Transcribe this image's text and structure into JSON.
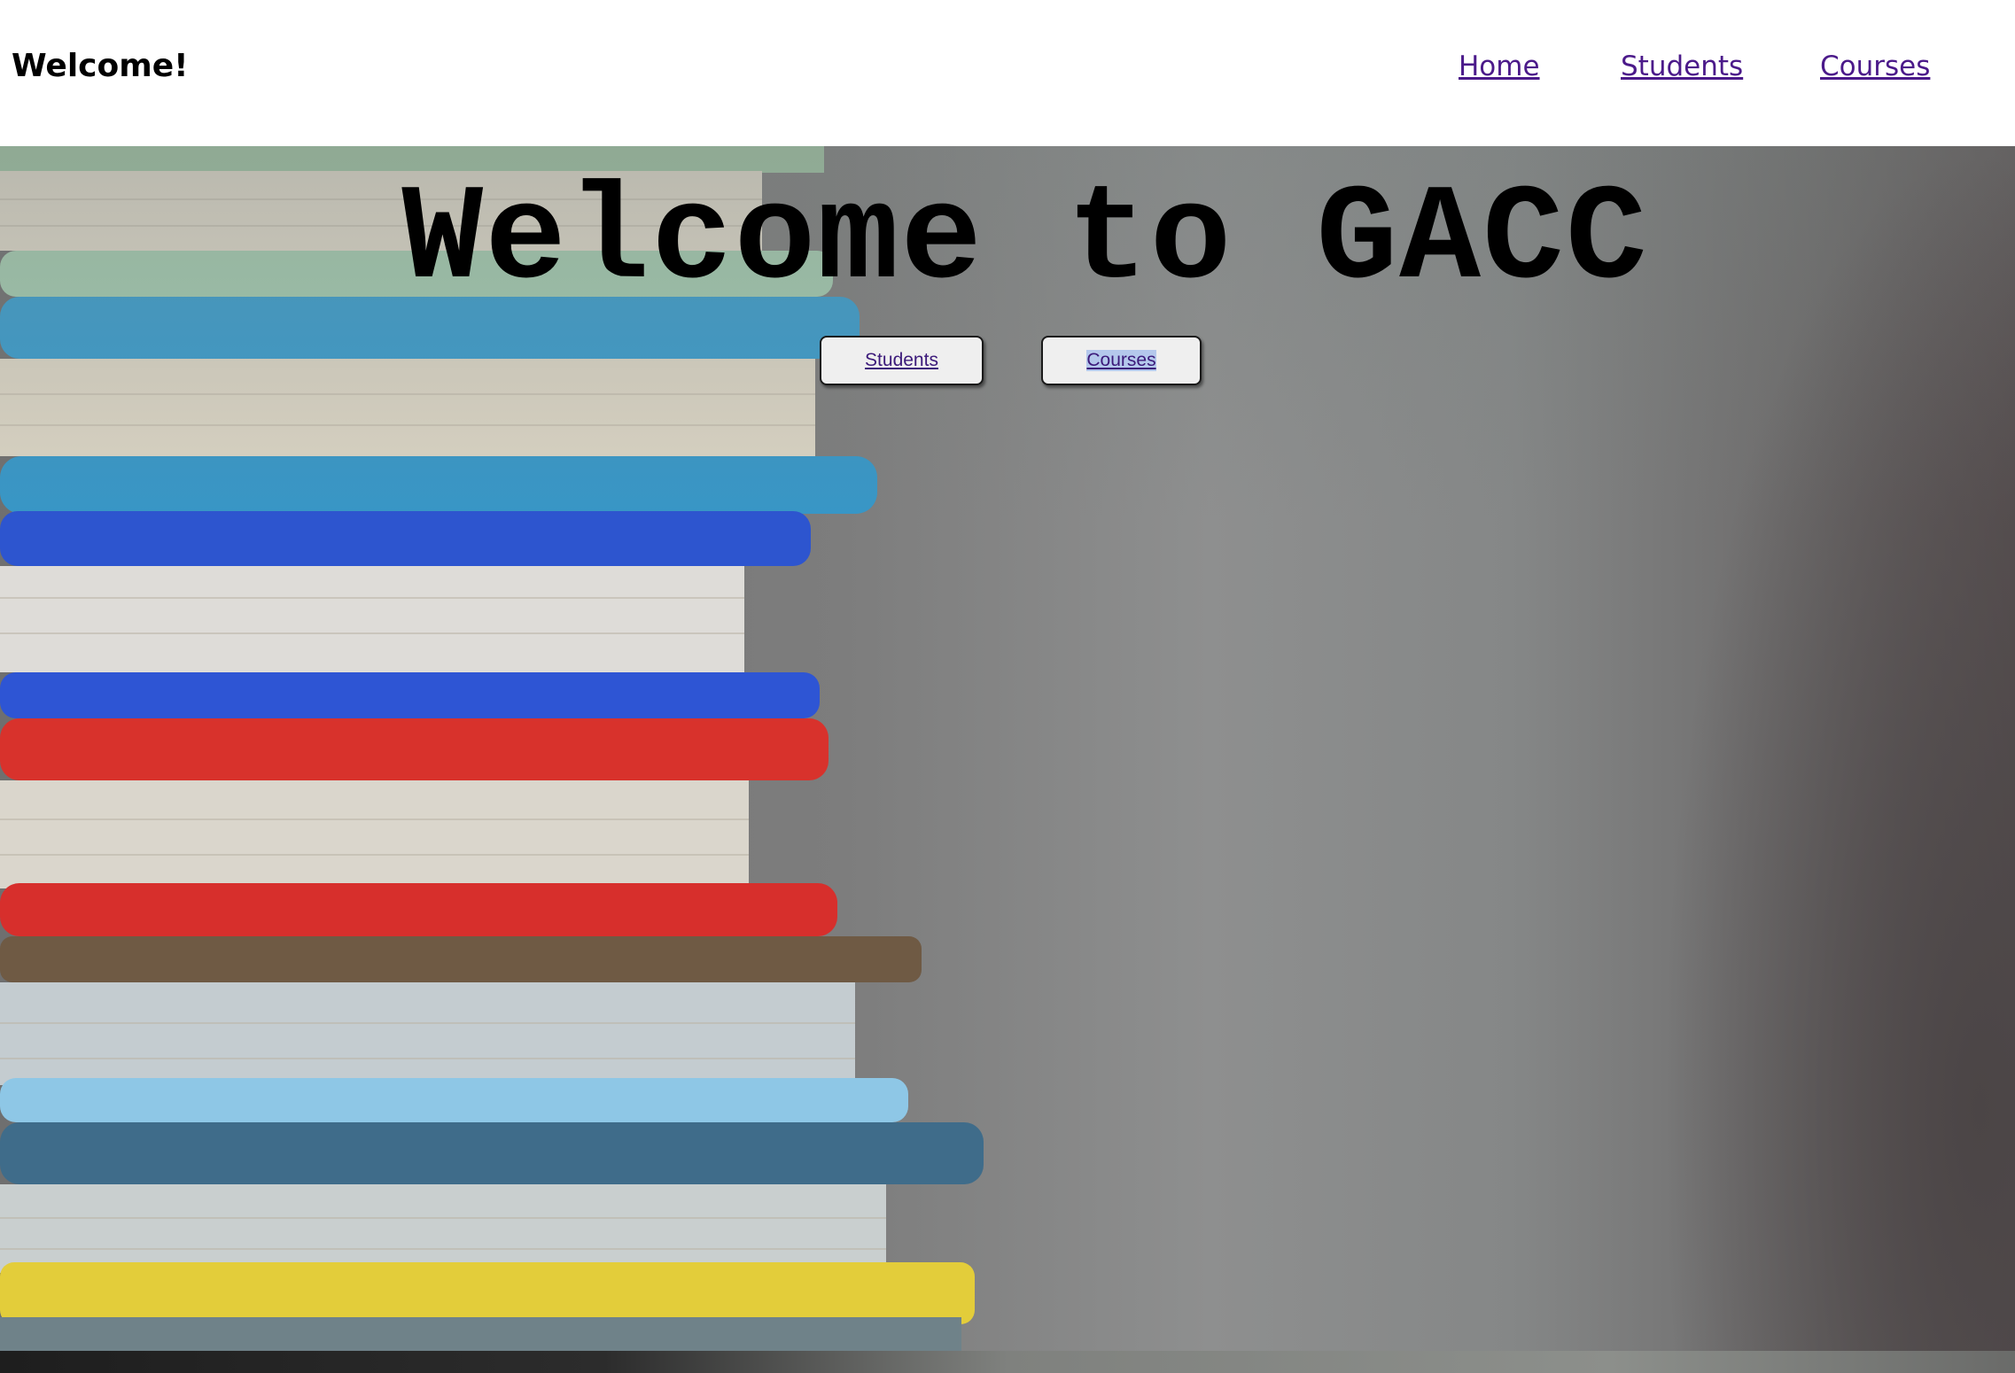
{
  "header": {
    "brand": "Welcome!",
    "nav": [
      {
        "label": "Home"
      },
      {
        "label": "Students"
      },
      {
        "label": "Courses"
      }
    ]
  },
  "hero": {
    "title": "Welcome to GACC",
    "buttons": [
      {
        "label": "Students"
      },
      {
        "label": "Courses",
        "selected": true
      }
    ],
    "background": "stack of colorful hardcover books photo"
  },
  "colors": {
    "link": "#4b1a8a",
    "button_bg": "#efefef",
    "selection": "#b4c8ec"
  }
}
